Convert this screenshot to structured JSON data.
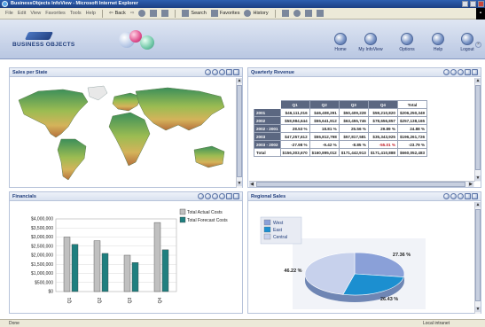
{
  "window": {
    "title": "BusinessObjects InfoView - Microsoft Internet Explorer",
    "menu": [
      "File",
      "Edit",
      "View",
      "Favorites",
      "Tools",
      "Help"
    ],
    "toolbar": {
      "back": "Back",
      "search": "Search",
      "favorites": "Favorites",
      "history": "History"
    }
  },
  "brand": {
    "name": "BUSINESS OBJECTS"
  },
  "nav": [
    {
      "label": "Home",
      "icon": "home-icon"
    },
    {
      "label": "My InfoView",
      "icon": "my-infoview-icon"
    },
    {
      "label": "Options",
      "icon": "options-icon"
    },
    {
      "label": "Help",
      "icon": "help-icon"
    },
    {
      "label": "Logout",
      "icon": "logout-icon"
    }
  ],
  "panels": {
    "sales_per_state": {
      "title": "Sales per State"
    },
    "quarterly_revenue": {
      "title": "Quarterly Revenue",
      "columns": [
        "Q1",
        "Q2",
        "Q3",
        "Q4",
        "Total"
      ],
      "rows": [
        {
          "label": "2001",
          "values": [
            "$46,111,016",
            "$46,408,291",
            "$50,409,228",
            "$59,210,820",
            "$206,250,349"
          ],
          "negative": [
            false,
            false,
            false,
            false,
            false
          ]
        },
        {
          "label": "2002",
          "values": [
            "$58,984,644",
            "$55,641,912",
            "$63,455,746",
            "$78,656,857",
            "$257,138,165"
          ],
          "negative": [
            false,
            false,
            false,
            false,
            false
          ]
        },
        {
          "label": "2002 - 2001",
          "values": [
            "28.53 %",
            "18.81 %",
            "25.56 %",
            "29.89 %",
            "24.88 %"
          ],
          "negative": [
            false,
            false,
            false,
            false,
            false
          ]
        },
        {
          "label": "2003",
          "values": [
            "$47,257,612",
            "$55,812,798",
            "$57,817,581",
            "$35,343,925",
            "$196,261,726"
          ],
          "negative": [
            false,
            false,
            false,
            false,
            false
          ]
        },
        {
          "label": "2003 - 2002",
          "values": [
            "-27.98 %",
            "-9.42 %",
            "-8.85 %",
            "-55.01 %",
            "-23.79 %"
          ],
          "negative": [
            false,
            false,
            false,
            true,
            false
          ]
        },
        {
          "label": "Total",
          "values": [
            "$156,303,670",
            "$160,895,012",
            "$171,442,913",
            "$171,410,888",
            "$660,052,483"
          ],
          "negative": [
            false,
            false,
            false,
            false,
            false
          ]
        }
      ]
    },
    "financials": {
      "title": "Financials"
    },
    "regional_sales": {
      "title": "Regional Sales"
    }
  },
  "chart_data": [
    {
      "type": "bar",
      "categories": [
        "Q1",
        "Q2",
        "Q3",
        "Q4"
      ],
      "series": [
        {
          "name": "Total Actual Costs",
          "values": [
            3000000,
            2800000,
            2000000,
            3800000
          ],
          "color": "#c0c0c0"
        },
        {
          "name": "Total Forecast Costs",
          "values": [
            2600000,
            2100000,
            1600000,
            2300000
          ],
          "color": "#1f7f7f"
        }
      ],
      "ylim": [
        0,
        4000000
      ],
      "yticks": [
        "$0",
        "$500,000",
        "$1,000,000",
        "$1,500,000",
        "$2,000,000",
        "$2,500,000",
        "$3,000,000",
        "$3,500,000",
        "$4,000,000"
      ],
      "legend": "top-right"
    },
    {
      "type": "pie",
      "labels": [
        "West",
        "East",
        "Central"
      ],
      "values": [
        27.36,
        26.43,
        46.22
      ],
      "label_text": [
        "27.36 %",
        "26.43 %",
        "46.22 %"
      ],
      "colors": [
        "#8aa0d8",
        "#1c8fd0",
        "#c7d1ec"
      ],
      "legend": "top-left"
    }
  ],
  "statusbar": {
    "status": "Done",
    "zone": "Local intranet"
  }
}
